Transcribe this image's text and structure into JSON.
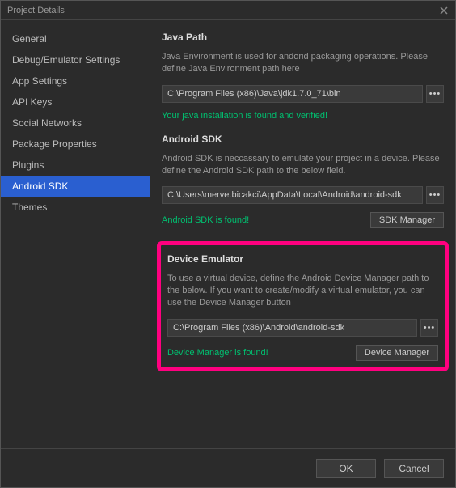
{
  "window": {
    "title": "Project Details"
  },
  "sidebar": {
    "items": [
      {
        "label": "General"
      },
      {
        "label": "Debug/Emulator Settings"
      },
      {
        "label": "App Settings"
      },
      {
        "label": "API Keys"
      },
      {
        "label": "Social Networks"
      },
      {
        "label": "Package Properties"
      },
      {
        "label": "Plugins"
      },
      {
        "label": "Android SDK"
      },
      {
        "label": "Themes"
      }
    ],
    "activeIndex": 7
  },
  "javaPath": {
    "title": "Java Path",
    "desc": "Java Environment is used for andorid packaging operations. Please define Java Environment path here",
    "value": "C:\\Program Files (x86)\\Java\\jdk1.7.0_71\\bin",
    "status": "Your java installation is found and verified!"
  },
  "androidSdk": {
    "title": "Android SDK",
    "desc": "Android SDK is neccassary to emulate your project in a device. Please define the Android SDK path to the below field.",
    "value": "C:\\Users\\merve.bicakci\\AppData\\Local\\Android\\android-sdk",
    "status": "Android SDK is found!",
    "button": "SDK Manager"
  },
  "deviceEmulator": {
    "title": "Device Emulator",
    "desc": "To use a virtual device, define the Android Device Manager path to the below. If you want to create/modify a virtual emulator, you can use the Device Manager button",
    "value": "C:\\Program Files (x86)\\Android\\android-sdk",
    "status": "Device Manager is found!",
    "button": "Device Manager"
  },
  "footer": {
    "ok": "OK",
    "cancel": "Cancel"
  },
  "browseDots": "•••"
}
